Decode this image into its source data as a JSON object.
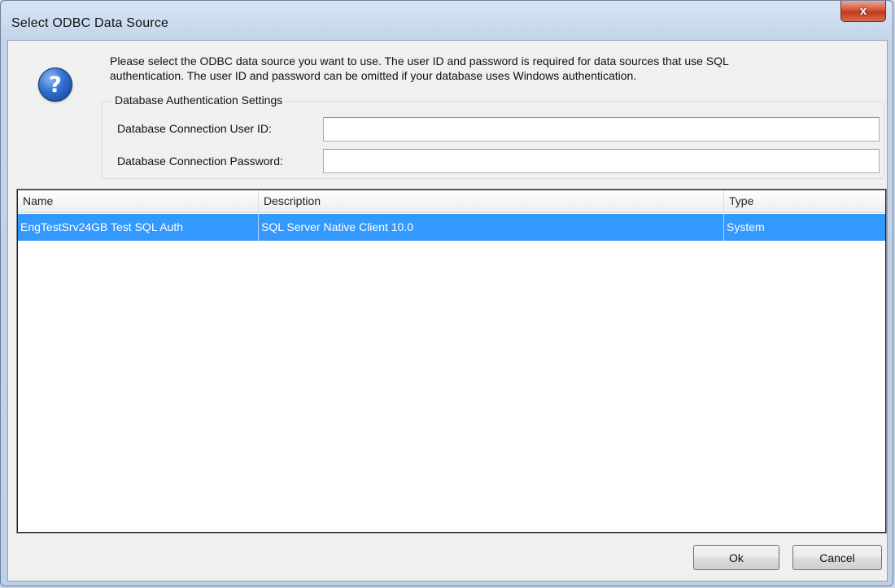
{
  "window": {
    "title": "Select ODBC Data Source",
    "close_label": "x"
  },
  "dialog": {
    "icon": "question-help-icon",
    "icon_glyph": "?",
    "instructions_line1": "Please select the ODBC data source you want to use.  The user ID and password is required for data sources that use SQL",
    "instructions_line2": "authentication.  The user ID and password can be omitted if your database uses Windows authentication."
  },
  "auth": {
    "group_title": "Database Authentication Settings",
    "user_id_label": "Database Connection User ID:",
    "user_id_value": "",
    "password_label": "Database Connection Password:",
    "password_value": ""
  },
  "datasources": {
    "columns": [
      "Name",
      "Description",
      "Type"
    ],
    "rows": [
      {
        "name": "EngTestSrv24GB Test SQL Auth",
        "description": "SQL Server Native Client 10.0",
        "type": "System",
        "selected": true
      }
    ]
  },
  "buttons": {
    "ok": "Ok",
    "cancel": "Cancel"
  },
  "colors": {
    "selection": "#3399ff",
    "close_button": "#c2381f",
    "window_frame": "#bcd0e8"
  }
}
